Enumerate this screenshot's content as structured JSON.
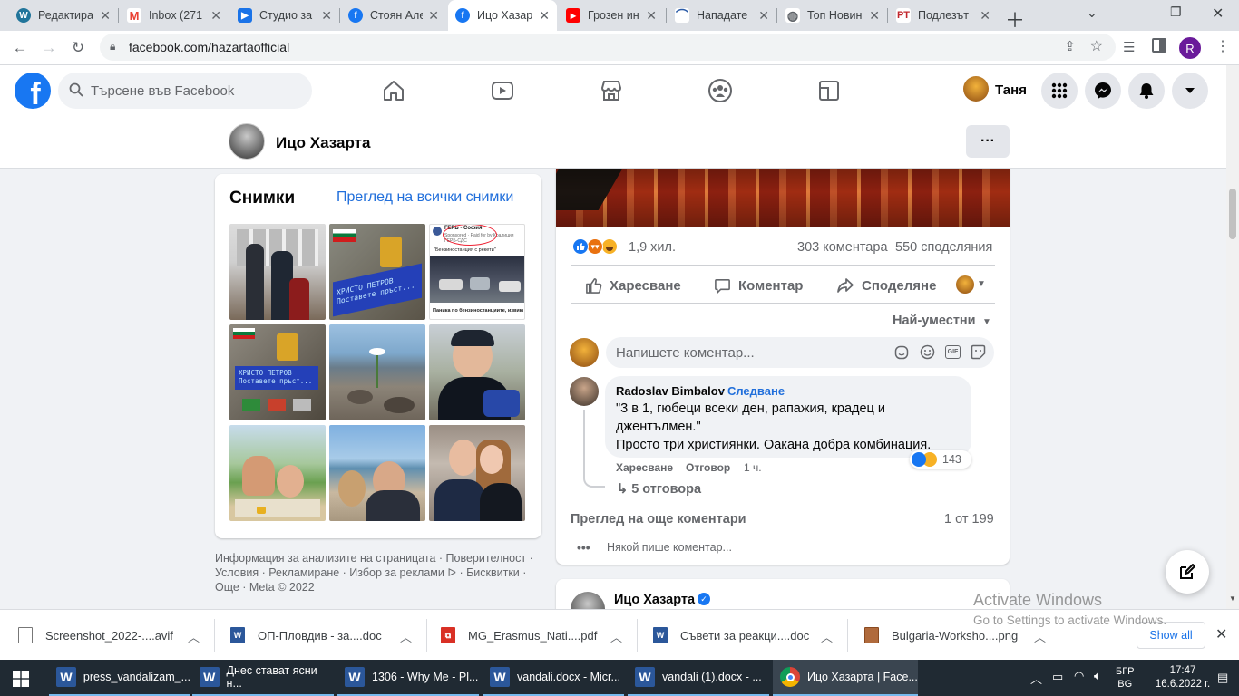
{
  "browser": {
    "tabs": [
      {
        "title": "Редактира",
        "icon": "wordpress-icon",
        "color": "#21759b"
      },
      {
        "title": "Inbox (271",
        "icon": "gmail-icon",
        "color": "#ea4335"
      },
      {
        "title": "Студио за",
        "icon": "youtube-studio-icon",
        "color": "#1a73e8"
      },
      {
        "title": "Стоян Але",
        "icon": "facebook-icon",
        "color": "#1877f2"
      },
      {
        "title": "Ицо Хазар",
        "icon": "facebook-icon",
        "color": "#1877f2"
      },
      {
        "title": "Грозен ин",
        "icon": "youtube-icon",
        "color": "#ff0000"
      },
      {
        "title": "Нападате",
        "icon": "news-icon",
        "color": "#2a5ba7"
      },
      {
        "title": "Топ Новин",
        "icon": "globe-icon",
        "color": "#5f6368"
      },
      {
        "title": "Подлезът",
        "icon": "pt-icon",
        "color": "#c1272d"
      }
    ],
    "url": "facebook.com/hazartaofficial",
    "profile_initial": "R"
  },
  "fb": {
    "search_placeholder": "Търсене във Facebook",
    "user_name": "Таня",
    "page_name": "Ицо Хазарта",
    "more_btn": "···"
  },
  "photos": {
    "title": "Снимки",
    "see_all": "Преглед на всички снимки",
    "photo3_header": "ГЕРБ - София",
    "photo3_sub": "Sponsored · Paid for by Коалиция ГЕРБ-СДС",
    "photo3_caption": "\"Бензиностанция с рекети\"",
    "photo3_bottom": "Паника по бензиностанциите, извика",
    "screen_text_1": "ХРИСТО ПЕТРОВ",
    "screen_text_2": "Поставете пръст..."
  },
  "footer": {
    "line1": "Информация за анализите на страницата · Поверителност ·",
    "line2": "Условия · Рекламиране · Избор за реклами ᐅ · Бисквитки ·",
    "line3": "Още · Meta © 2022"
  },
  "post": {
    "reactions_count": "1,9 хил.",
    "comments_count": "303 коментара",
    "shares_count": "550 споделяния",
    "like": "Харесване",
    "comment": "Коментар",
    "share": "Споделяне",
    "sort_label": "Най-уместни",
    "comment_placeholder": "Напишете коментар...",
    "gif_label": "GIF"
  },
  "top_comment": {
    "author": "Radoslav Bimbalov",
    "follow": "Следване",
    "text_line1": "\"3 в 1, гюбеци всеки ден, рапажия, крадец и",
    "text_line2": "джентълмен.\"",
    "text_line3": "Просто три християнки. Оакана добра комбинация.",
    "reaction_count": "143",
    "like": "Харесване",
    "reply": "Отговор",
    "time": "1 ч.",
    "replies": "5 отговора"
  },
  "more_comments": {
    "label": "Преглед на още коментари",
    "counter": "1 от 199",
    "typing": "Някой пише коментар..."
  },
  "next_post": {
    "author": "Ицо Хазарта"
  },
  "watermark": {
    "line1": "Activate Windows",
    "line2": "Go to Settings to activate Windows."
  },
  "downloads": {
    "items": [
      {
        "name": "Screenshot_2022-....avif",
        "type": "file",
        "color": "#ffffff"
      },
      {
        "name": "ОП-Пловдив - за....doc",
        "type": "word",
        "color": "#2b579a"
      },
      {
        "name": "MG_Erasmus_Nati....pdf",
        "type": "pdf",
        "color": "#d93025"
      },
      {
        "name": "Съвети за реакци....doc",
        "type": "word",
        "color": "#2b579a"
      },
      {
        "name": "Bulgaria-Worksho....png",
        "type": "image",
        "color": "#b06a3c"
      }
    ],
    "show_all": "Show all"
  },
  "taskbar": {
    "items": [
      {
        "title": "press_vandalizam_..."
      },
      {
        "title": "Днес стават ясни н..."
      },
      {
        "title": "1306 - Why Me - Pl..."
      },
      {
        "title": "vandali.docx - Micr..."
      },
      {
        "title": "vandali (1).docx - ..."
      },
      {
        "title": "Ицо Хазарта | Face..."
      }
    ],
    "lang_top": "БГР",
    "lang_bottom": "BG",
    "time": "17:47",
    "date": "16.6.2022 г."
  }
}
